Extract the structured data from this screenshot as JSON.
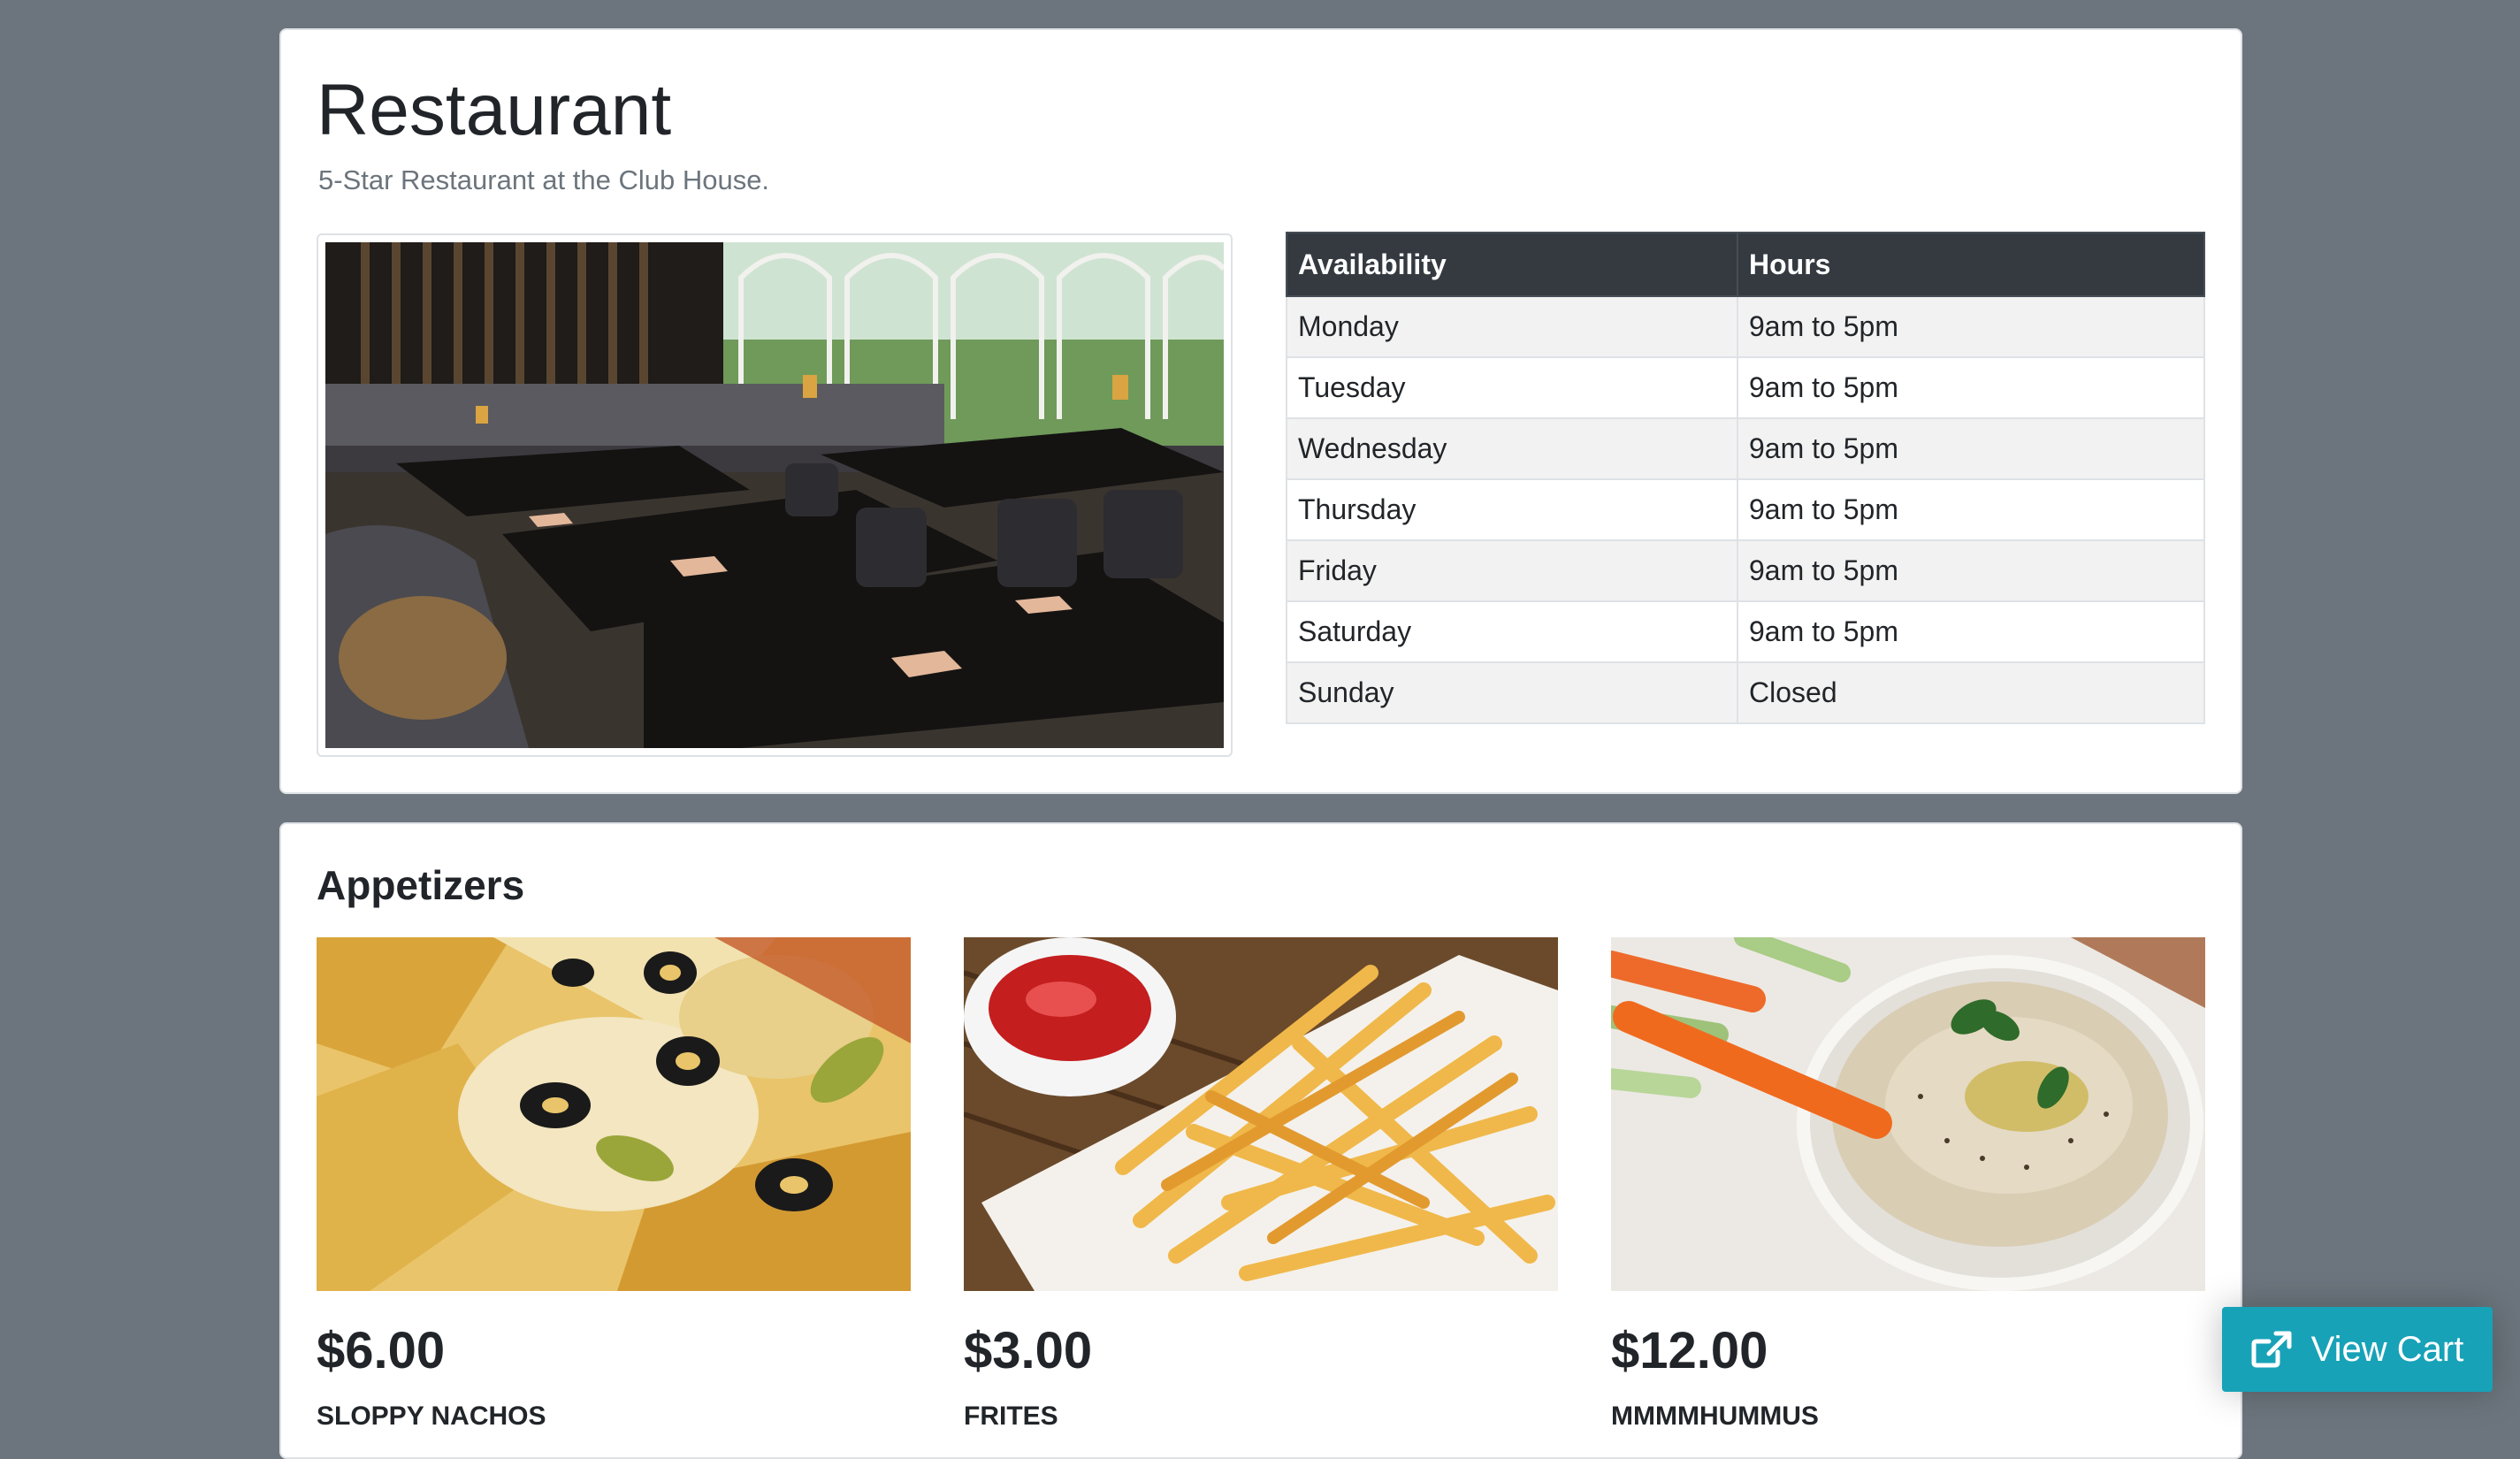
{
  "header": {
    "title": "Restaurant",
    "subtitle": "5-Star Restaurant at the Club House."
  },
  "hours_table": {
    "columns": [
      "Availability",
      "Hours"
    ],
    "rows": [
      {
        "day": "Monday",
        "hours": "9am to 5pm"
      },
      {
        "day": "Tuesday",
        "hours": "9am to 5pm"
      },
      {
        "day": "Wednesday",
        "hours": "9am to 5pm"
      },
      {
        "day": "Thursday",
        "hours": "9am to 5pm"
      },
      {
        "day": "Friday",
        "hours": "9am to 5pm"
      },
      {
        "day": "Saturday",
        "hours": "9am to 5pm"
      },
      {
        "day": "Sunday",
        "hours": "Closed"
      }
    ]
  },
  "menu": {
    "section_title": "Appetizers",
    "items": [
      {
        "price": "$6.00",
        "name": "SLOPPY NACHOS",
        "image": "nachos-photo"
      },
      {
        "price": "$3.00",
        "name": "FRITES",
        "image": "fries-photo"
      },
      {
        "price": "$12.00",
        "name": "MMMMHUMMUS",
        "image": "hummus-photo"
      }
    ]
  },
  "cart_button": {
    "label": "View Cart",
    "icon": "external-link-icon"
  },
  "colors": {
    "page_bg": "#6c757d",
    "table_header": "#343a40",
    "cart_button": "#17a2b8"
  }
}
